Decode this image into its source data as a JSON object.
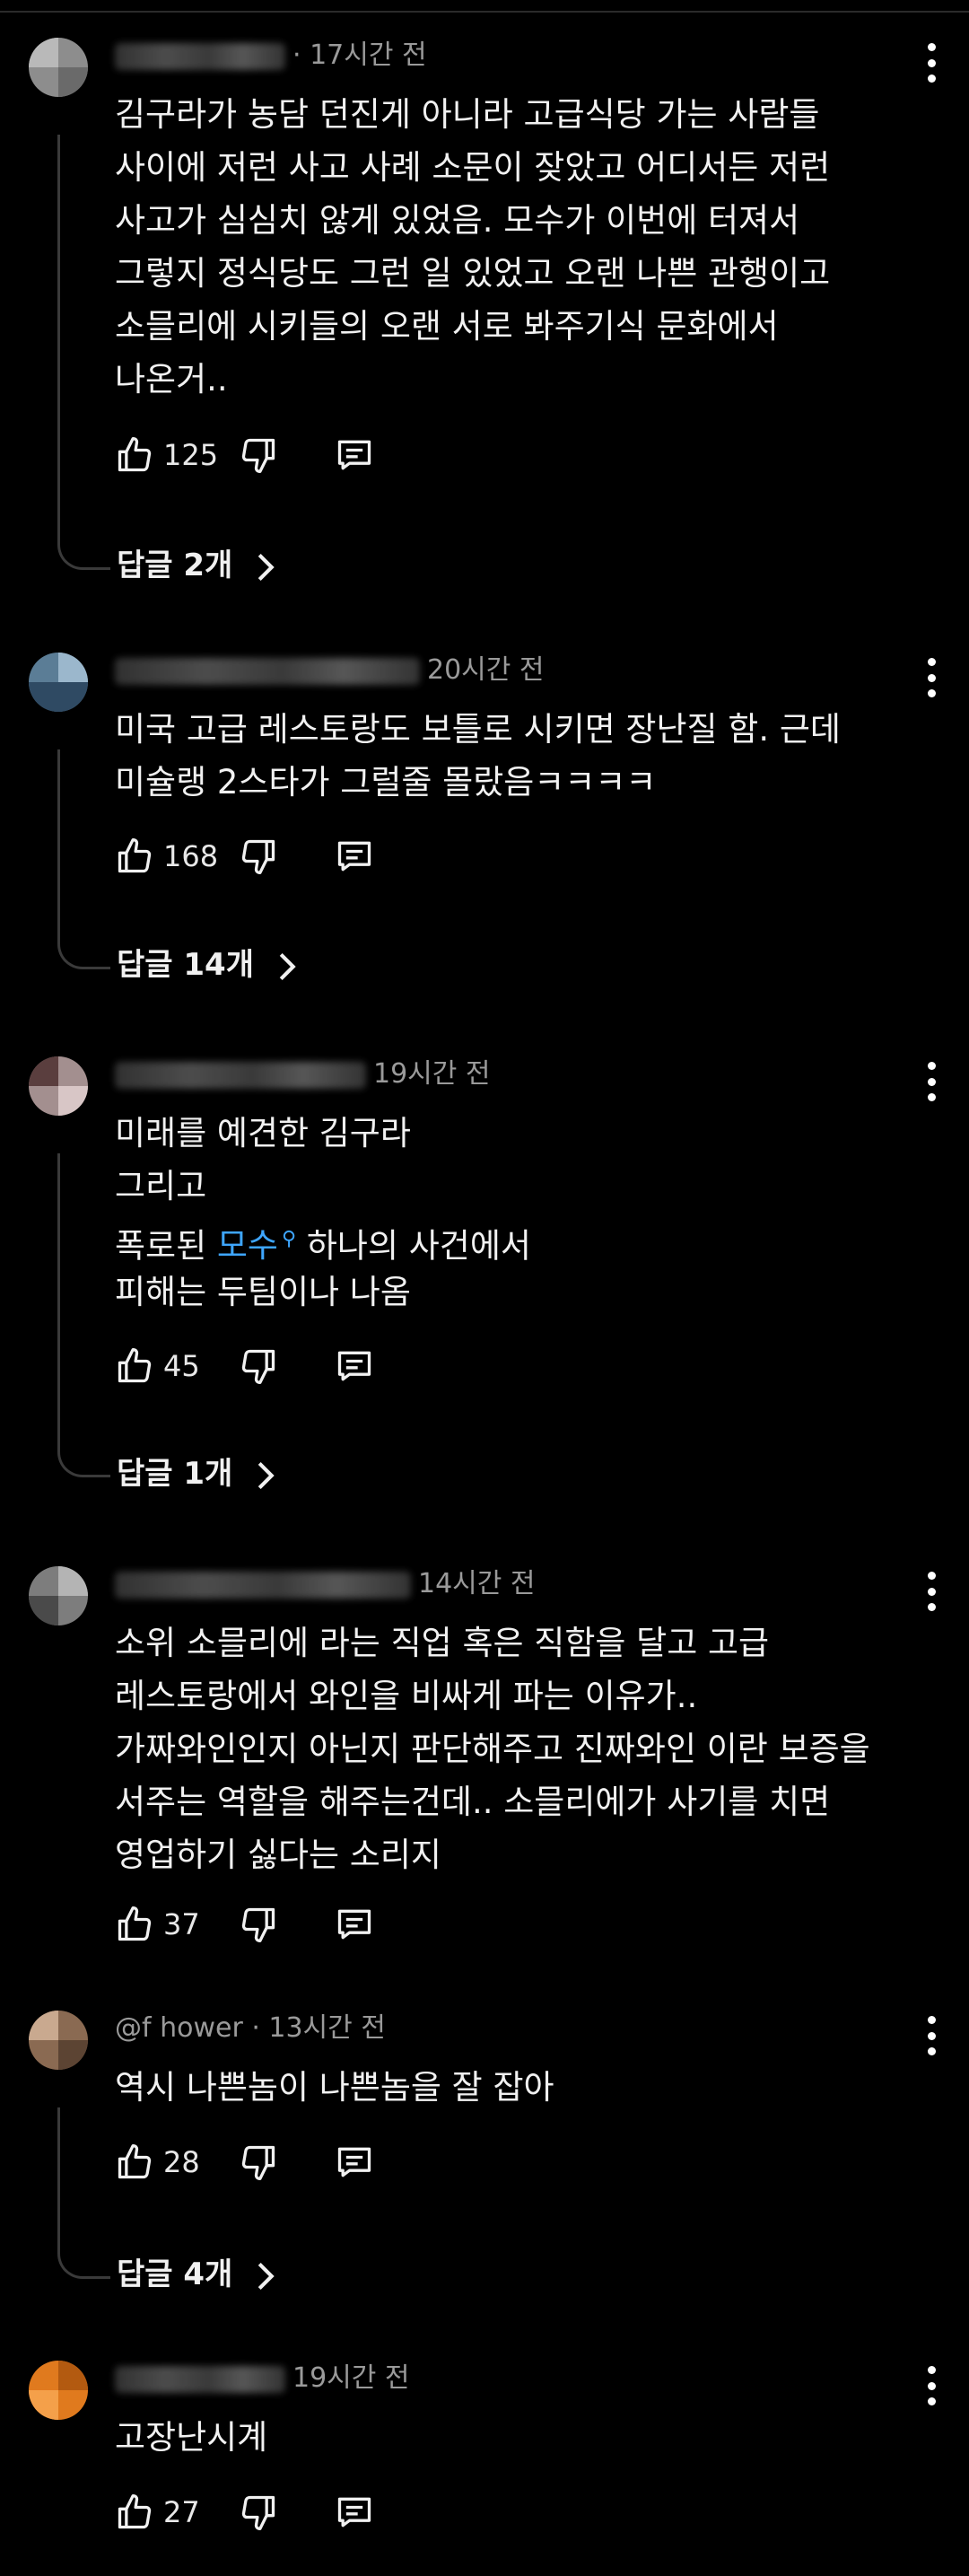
{
  "comments": [
    {
      "meta": "@갱갱ㅎ511 · 17시간 전",
      "meta_visible": "@갱갱ㅎ511 · 17시간 전",
      "lines": [
        "김구라가 농담 던진게 아니라 고급식당 가는 사람들",
        "사이에 저런 사고 사례 소문이 잦았고 어디서든 저런",
        "사고가 심심치 않게 있었음. 모수가 이번에 터져서",
        "그렇지 정식당도 그런 일 있었고 오랜 나쁜 관행이고",
        "소믈리에 시키들의 오랜 서로 봐주기식 문화에서",
        "나온거.."
      ],
      "likes": "125",
      "replies": "답글 2개"
    },
    {
      "meta": "20시간 전",
      "lines": [
        "미국 고급 레스토랑도 보틀로 시키면 장난질 함. 근데",
        "미슐랭 2스타가 그럴줄 몰랐음ㅋㅋㅋㅋ"
      ],
      "likes": "168",
      "replies": "답글 14개"
    },
    {
      "meta": "19시간 전",
      "lines_pre": [
        "미래를 예견한 김구라",
        "그리고"
      ],
      "line_mention_pre": "폭로된 ",
      "mention": "모수",
      "line_mention_post": " 하나의 사건에서",
      "lines_post": [
        "피해는 두팀이나 나옴"
      ],
      "likes": "45",
      "replies": "답글 1개"
    },
    {
      "meta": "14시간 전",
      "lines": [
        "소위 소믈리에 라는 직업 혹은 직함을 달고 고급",
        "레스토랑에서 와인을 비싸게 파는 이유가..",
        "가짜와인인지 아닌지 판단해주고 진짜와인 이란 보증을",
        "서주는 역할을 해주는건데.. 소믈리에가 사기를 치면",
        "영업하기 싫다는 소리지"
      ],
      "likes": "37"
    },
    {
      "meta": "@f    hower · 13시간 전",
      "lines": [
        "역시 나쁜놈이 나쁜놈을 잘 잡아"
      ],
      "likes": "28",
      "replies": "답글 4개"
    },
    {
      "meta": "19시간 전",
      "lines": [
        "고장난시계"
      ],
      "likes": "27"
    }
  ],
  "icons": {
    "like": "thumbs-up-icon",
    "dislike": "thumbs-down-icon",
    "reply": "comment-reply-icon",
    "more": "more-vert-icon",
    "chevron": "chevron-right-icon"
  },
  "colors": {
    "background": "#000000",
    "text": "#f1f1f1",
    "meta": "#9a9a9a",
    "mention": "#3ea6ff"
  }
}
